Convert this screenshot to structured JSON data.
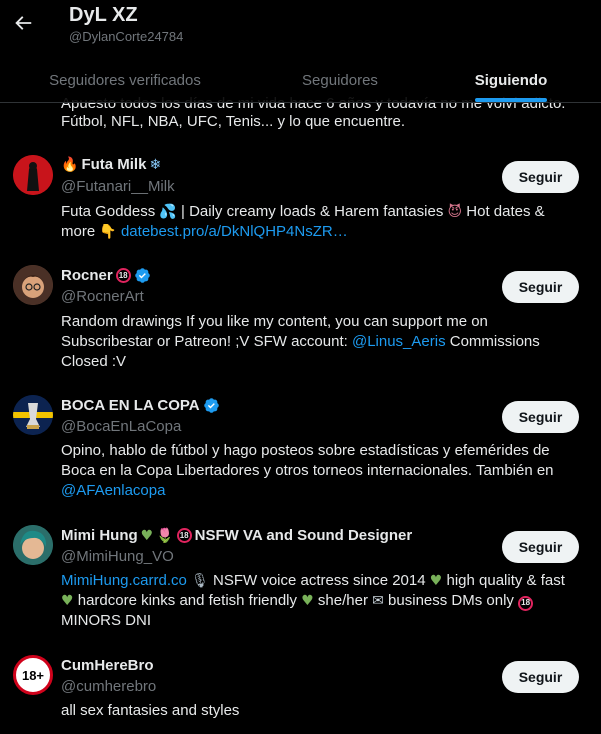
{
  "header": {
    "name": "DyL XZ",
    "handle": "@DylanCorte24784",
    "tabs": [
      {
        "label": "Seguidores verificados"
      },
      {
        "label": "Seguidores"
      },
      {
        "label": "Siguiendo"
      }
    ],
    "active_tab": "Siguiendo"
  },
  "top_bio_cut": {
    "line1": "Apuesto todos los días de mi vida hace 6 años y todavía no me volví adicto.",
    "line2": "Fútbol, NFL, NBA, UFC, Tenis... y lo que encuentre."
  },
  "users": [
    {
      "name_prefix_icon": "fire-icon",
      "name": "Futa Milk",
      "name_suffix_icon": "snowflake-icon",
      "handle": "@Futanari__Milk",
      "button": "Seguir",
      "bio_line1": "Futa Goddess",
      "bio_line1b": "| Daily creamy loads & Harem fantasies",
      "bio_line1c": "Hot dates &",
      "bio_line2": "more",
      "bio_link": "datebest.pro/a/DkNlQHP4NsZR…"
    },
    {
      "name": "Rocner",
      "handle": "@RocnerArt",
      "button": "Seguir",
      "bio_line1": "Random drawings If you like my content, you can support me on",
      "bio_line2a": "Subscribestar or Patreon! ;V SFW account:",
      "bio_mention": "@Linus_Aeris",
      "bio_line2b": "Commissions",
      "bio_line3": "Closed :V"
    },
    {
      "name": "BOCA EN LA COPA",
      "handle": "@BocaEnLaCopa",
      "button": "Seguir",
      "bio_line1": "Opino, hablo de fútbol y hago posteos sobre estadísticas y efemérides de",
      "bio_line2": "Boca en la Copa Libertadores y otros torneos internacionales. También en",
      "bio_mention": "@AFAenlacopa"
    },
    {
      "name_a": "Mimi Hung",
      "name_b": "NSFW VA and Sound Designer",
      "handle": "@MimiHung_VO",
      "button": "Seguir",
      "bio_link": "MimiHung.carrd.co",
      "bio_line1": "NSFW voice actress since 2014",
      "bio_line1b": "high quality & fast",
      "bio_line2a": "hardcore kinks and fetish friendly",
      "bio_line2b": "she/her",
      "bio_line2c": "business DMs only",
      "bio_line3": "MINORS DNI"
    },
    {
      "name": "CumHereBro",
      "handle": "@cumherebro",
      "button": "Seguir",
      "bio_line1": "all sex fantasies and styles",
      "avatar_text": "18+"
    }
  ],
  "badge_18_text": "18",
  "colors": {
    "accent": "#1d9bf0",
    "background": "#000000",
    "muted": "#71767b",
    "text": "#e7e9ea"
  }
}
